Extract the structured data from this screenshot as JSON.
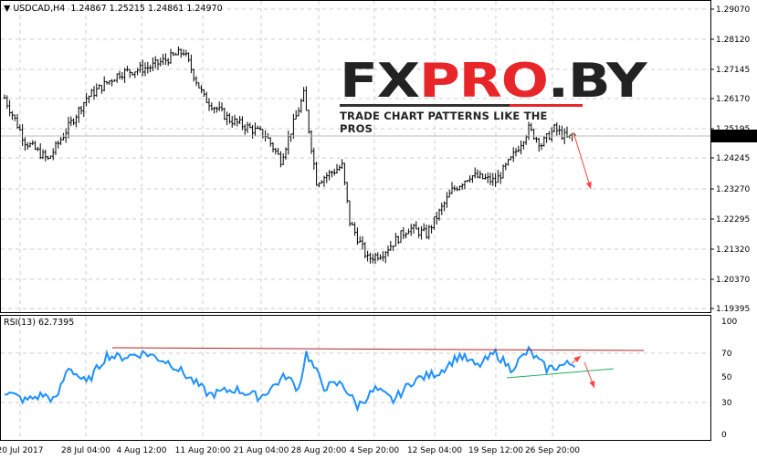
{
  "header": {
    "symbol": "USDCAD,H4",
    "open": "1.24867",
    "high": "1.25215",
    "low": "1.24861",
    "close": "1.24970"
  },
  "logo": {
    "brand_a": "FX",
    "brand_b": "PRO",
    "brand_c": ".BY",
    "tagline": "TRADE CHART PATTERNS LIKE THE PROS"
  },
  "price_axis": [
    "1.29070",
    "1.28120",
    "1.27145",
    "1.26170",
    "1.25195",
    "1.24245",
    "1.23270",
    "1.22295",
    "1.21320",
    "1.20370",
    "1.19395"
  ],
  "current_price": "1.24970",
  "rsi": {
    "label": "RSI(13) 62.7395",
    "axis": [
      "100",
      "70",
      "50",
      "30",
      "0"
    ]
  },
  "time_axis": [
    "20 Jul 2017",
    "28 Jul 04:00",
    "4 Aug 12:00",
    "11 Aug 20:00",
    "21 Aug 04:00",
    "28 Aug 20:00",
    "4 Sep 20:00",
    "12 Sep 04:00",
    "19 Sep 12:00",
    "26 Sep 20:00"
  ],
  "colors": {
    "bars": "#000000",
    "rsi": "#1e90ff",
    "resistance": "#b22222",
    "support": "#20b060",
    "arrow": "#ff4040"
  },
  "chart_data": {
    "type": "ohlc",
    "price_keypoints": {
      "bar": [
        0,
        8,
        17,
        23,
        32,
        45,
        57,
        70,
        78,
        88,
        102,
        108,
        117,
        122,
        132,
        135,
        142,
        148,
        158,
        165,
        175,
        182,
        192,
        198,
        205,
        210,
        215,
        220,
        223
      ],
      "close": [
        1.262,
        1.248,
        1.242,
        1.25,
        1.262,
        1.27,
        1.272,
        1.277,
        1.262,
        1.255,
        1.25,
        1.242,
        1.263,
        1.235,
        1.24,
        1.222,
        1.21,
        1.212,
        1.22,
        1.218,
        1.232,
        1.237,
        1.235,
        1.242,
        1.252,
        1.247,
        1.252,
        1.249,
        1.2497
      ]
    },
    "rsi_keypoints": {
      "bar": [
        0,
        8,
        15,
        20,
        25,
        32,
        40,
        45,
        55,
        65,
        75,
        80,
        90,
        100,
        110,
        115,
        118,
        125,
        132,
        138,
        145,
        152,
        160,
        170,
        178,
        185,
        192,
        198,
        205,
        212,
        220,
        223
      ],
      "value": [
        38,
        30,
        35,
        30,
        60,
        45,
        70,
        68,
        72,
        63,
        45,
        35,
        40,
        33,
        52,
        40,
        72,
        42,
        45,
        25,
        40,
        30,
        48,
        55,
        70,
        60,
        72,
        58,
        74,
        58,
        62,
        62.7
      ]
    },
    "ylim": [
      1.19395,
      1.2907
    ],
    "rsi_ylim": [
      0,
      100
    ]
  }
}
